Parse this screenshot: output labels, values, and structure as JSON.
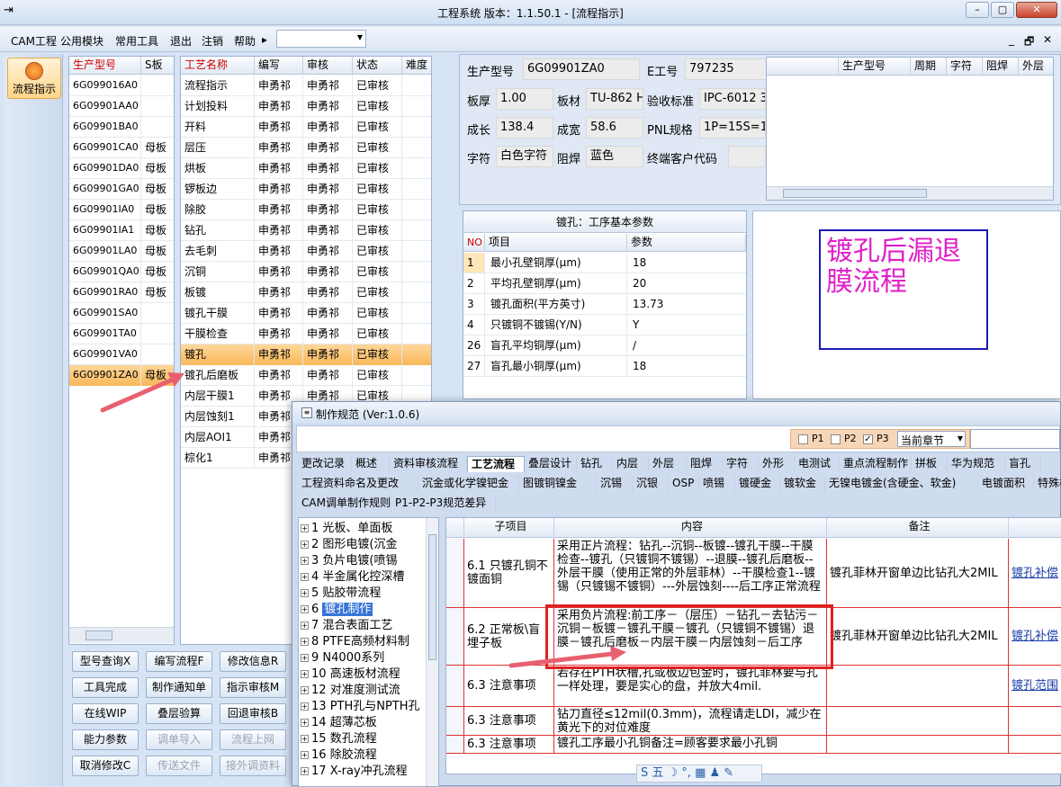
{
  "window": {
    "title": "工程系统   版本：1.1.50.1 - [流程指示]",
    "min": "–",
    "restore": "▢",
    "close": "✕"
  },
  "menu": [
    "CAM工程",
    "公用模块",
    "常用工具",
    "退出",
    "注销",
    "帮助"
  ],
  "menu_arrow": "▸",
  "side": {
    "label": "流程指示"
  },
  "models": {
    "headers": [
      "生产型号",
      "S板"
    ],
    "rows": [
      [
        "6G099016A0",
        ""
      ],
      [
        "6G09901AA0",
        ""
      ],
      [
        "6G09901BA0",
        ""
      ],
      [
        "6G09901CA0",
        "母板"
      ],
      [
        "6G09901DA0",
        "母板"
      ],
      [
        "6G09901GA0",
        "母板"
      ],
      [
        "6G09901IA0",
        "母板"
      ],
      [
        "6G09901IA1",
        "母板"
      ],
      [
        "6G09901LA0",
        "母板"
      ],
      [
        "6G09901QA0",
        "母板"
      ],
      [
        "6G09901RA0",
        "母板"
      ],
      [
        "6G09901SA0",
        ""
      ],
      [
        "6G09901TA0",
        ""
      ],
      [
        "6G09901VA0",
        ""
      ],
      [
        "6G09901ZA0",
        "母板"
      ]
    ]
  },
  "process": {
    "headers": [
      "工艺名称",
      "编写",
      "审核",
      "状态",
      "难度"
    ],
    "rows": [
      [
        "流程指示",
        "申勇祁",
        "申勇祁",
        "已审核",
        ""
      ],
      [
        "计划投料",
        "申勇祁",
        "申勇祁",
        "已审核",
        ""
      ],
      [
        "开料",
        "申勇祁",
        "申勇祁",
        "已审核",
        ""
      ],
      [
        "层压",
        "申勇祁",
        "申勇祁",
        "已审核",
        ""
      ],
      [
        "烘板",
        "申勇祁",
        "申勇祁",
        "已审核",
        ""
      ],
      [
        "锣板边",
        "申勇祁",
        "申勇祁",
        "已审核",
        ""
      ],
      [
        "除胶",
        "申勇祁",
        "申勇祁",
        "已审核",
        ""
      ],
      [
        "钻孔",
        "申勇祁",
        "申勇祁",
        "已审核",
        ""
      ],
      [
        "去毛刺",
        "申勇祁",
        "申勇祁",
        "已审核",
        ""
      ],
      [
        "沉铜",
        "申勇祁",
        "申勇祁",
        "已审核",
        ""
      ],
      [
        "板镀",
        "申勇祁",
        "申勇祁",
        "已审核",
        ""
      ],
      [
        "镀孔干膜",
        "申勇祁",
        "申勇祁",
        "已审核",
        ""
      ],
      [
        "干膜检查",
        "申勇祁",
        "申勇祁",
        "已审核",
        ""
      ],
      [
        "镀孔",
        "申勇祁",
        "申勇祁",
        "已审核",
        ""
      ],
      [
        "镀孔后磨板",
        "申勇祁",
        "申勇祁",
        "已审核",
        ""
      ],
      [
        "内层干膜1",
        "申勇祁",
        "申勇祁",
        "已审核",
        ""
      ],
      [
        "内层蚀刻1",
        "申勇祁",
        "",
        "",
        " "
      ],
      [
        "内层AOI1",
        "申勇祁",
        "",
        "",
        ""
      ],
      [
        "棕化1",
        "申勇祁",
        "",
        "",
        ""
      ]
    ]
  },
  "buttons": [
    [
      "型号查询X",
      "编写流程F",
      "修改信息R"
    ],
    [
      "工具完成",
      "制作通知单",
      "指示审核M"
    ],
    [
      "在线WIP",
      "叠层验算",
      "回退审核B"
    ],
    [
      "能力参数",
      "调单导入",
      "流程上网"
    ],
    [
      "取消修改C",
      "传送文件",
      "接外调资料"
    ]
  ],
  "info": {
    "prod_label": "生产型号",
    "prod": "6G09901ZA0",
    "e_label": "E工号",
    "e": "797235",
    "thick_label": "板厚",
    "thick": "1.00",
    "mat_label": "板材",
    "mat": "TU-862 H",
    "std_label": "验收标准",
    "std": "IPC-6012 3",
    "len_label": "成长",
    "len": "138.4",
    "wid_label": "成宽",
    "wid": "58.6",
    "pnl_label": "PNL规格",
    "pnl": "1P=15S=15",
    "char_label": "字符",
    "char": "白色字符",
    "mask_label": "阻焊",
    "mask": "蓝色",
    "cust_label": "终端客户代码",
    "cust": ""
  },
  "right_table": {
    "headers": [
      "生产型号",
      "周期",
      "字符",
      "阻焊",
      "外层"
    ]
  },
  "params": {
    "title": "镀孔：工序基本参数",
    "headers": [
      "NO",
      "项目",
      "参数"
    ],
    "rows": [
      [
        "1",
        "最小孔壁铜厚(μm)",
        "18"
      ],
      [
        "2",
        "平均孔壁铜厚(μm)",
        "20"
      ],
      [
        "3",
        "镀孔面积(平方英寸)",
        "13.73"
      ],
      [
        "4",
        "只镀铜不镀锡(Y/N)",
        "Y"
      ],
      [
        "26",
        "盲孔平均铜厚(μm)",
        "/"
      ],
      [
        "27",
        "盲孔最小铜厚(μm)",
        "18"
      ]
    ]
  },
  "note_box": "镀孔后漏退膜流程",
  "dialog": {
    "title": "制作规范 (Ver:1.0.6)",
    "p1": "P1",
    "p2": "P2",
    "p3": "P3",
    "chapter": "当前章节",
    "tabs1": [
      "更改记录",
      "概述",
      "资料审核流程",
      "工艺流程",
      "叠层设计",
      "钻孔",
      "内层",
      "外层",
      "阻焊",
      "字符",
      "外形",
      "电测试",
      "重点流程制作",
      "拼板",
      "华为规范",
      "盲孔"
    ],
    "tabs2": [
      "工程资料命名及更改",
      "沉金或化学镍钯金",
      "图镀铜镍金",
      "沉锡",
      "沉银",
      "OSP",
      "喷锡",
      "镀硬金",
      "镀软金",
      "无镍电镀金(含硬金、软金)",
      "电镀面积",
      "特殊板"
    ],
    "tabs3": [
      "CAM调单制作规则",
      "P1-P2-P3规范差异"
    ],
    "tree": [
      [
        "1",
        "光板、单面板"
      ],
      [
        "2",
        "图形电镀(沉金"
      ],
      [
        "3",
        "负片电镀(喷锡"
      ],
      [
        "4",
        "半金属化控深槽"
      ],
      [
        "5",
        "贴胶带流程"
      ],
      [
        "6",
        "镀孔制作"
      ],
      [
        "7",
        "混合表面工艺"
      ],
      [
        "8",
        "PTFE高频材料制"
      ],
      [
        "9",
        "N4000系列"
      ],
      [
        "10",
        "高速板材流程"
      ],
      [
        "12",
        "对准度测试流"
      ],
      [
        "13",
        "PTH孔与NPTH孔"
      ],
      [
        "14",
        "超薄芯板"
      ],
      [
        "15",
        "数孔流程"
      ],
      [
        "16",
        "除胶流程"
      ],
      [
        "17",
        "X-ray冲孔流程"
      ]
    ],
    "content_headers": [
      "子项目",
      "内容",
      "备注"
    ],
    "content_rows": [
      [
        "6.1 只镀孔铜不镀面铜",
        "采用正片流程：钻孔--沉铜--板镀--镀孔干膜--干膜检查--镀孔（只镀铜不镀锡）--退膜--镀孔后磨板--外层干膜（使用正常的外层菲林）--干膜检查1--镀锡（只镀锡不镀铜）---外层蚀刻----后工序正常流程",
        "镀孔菲林开窗单边比钻孔大2MIL",
        "镀孔补偿"
      ],
      [
        "6.2 正常板\\盲埋子板",
        "采用负片流程:前工序－（层压）－钻孔－去钻污－沉铜－板镀－镀孔干膜－镀孔（只镀铜不镀锡）退膜－镀孔后磨板－内层干膜－内层蚀刻－后工序",
        "镀孔菲林开窗单边比钻孔大2MIL",
        "镀孔补偿"
      ],
      [
        "6.3 注意事项",
        "若存在PTH状槽,孔或板边包金时，镀孔菲林要与孔一样处理，要是实心的盘，并放大4mil.",
        "",
        "镀孔范围"
      ],
      [
        "6.3 注意事项",
        "钻刀直径≤12mil(0.3mm)，流程请走LDI，减少在黄光下的对位难度",
        "",
        ""
      ],
      [
        "6.3 注意事项",
        "镀孔工序最小孔铜备注=顾客要求最小孔铜",
        "",
        ""
      ]
    ],
    "ime": "S 五 ☽ °, ▦ ♟ ✎"
  }
}
